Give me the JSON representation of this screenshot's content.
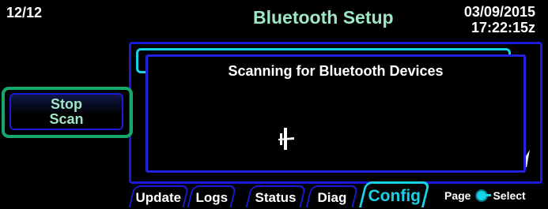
{
  "header": {
    "page_counter": "12/12",
    "title": "Bluetooth Setup",
    "date": "03/09/2015",
    "time": "17:22:15z"
  },
  "dialog": {
    "message": "Scanning for Bluetooth Devices",
    "icon": "airplane-icon"
  },
  "background_panel": {
    "partial_text": "..."
  },
  "softkeys": {
    "stop_scan_line1": "Stop",
    "stop_scan_line2": "Scan"
  },
  "tabs": [
    {
      "label": "Update"
    },
    {
      "label": "Logs"
    },
    {
      "label": "Status"
    },
    {
      "label": "Diag"
    },
    {
      "label": "Config",
      "active": true
    }
  ],
  "footer": {
    "page_label": "Page",
    "select_label": "Select",
    "knob_icon": "knob-icon"
  },
  "colors": {
    "background": "#000000",
    "title": "#9ee6c4",
    "frame_blue": "#1a1ad8",
    "accent_cyan": "#16d2e6",
    "button_green": "#15a86a"
  }
}
